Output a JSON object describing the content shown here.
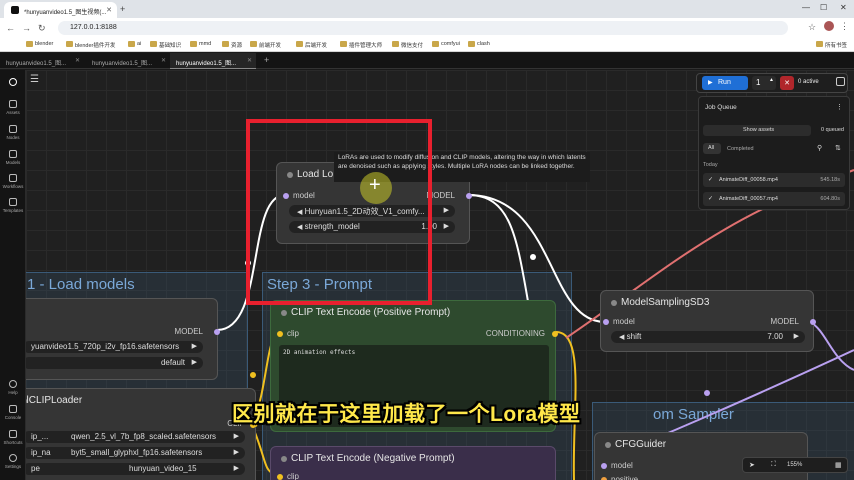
{
  "browser": {
    "tabs": [
      {
        "title": "*hunyuanvideo1.5_图生视频(...",
        "active": true
      }
    ],
    "url": "127.0.0.1:8188",
    "profile": "所有书签",
    "bookmarks": [
      "blender",
      "blender插件开发",
      "ai",
      "基础知识",
      "mmd",
      "资源",
      "前端开发",
      "后端开发",
      "插件管理大师",
      "微信支付",
      "comfyui",
      "clash"
    ]
  },
  "workflow_tabs": [
    {
      "label": "hunyuanvideo1.5_图...",
      "active": false
    },
    {
      "label": "hunyuanvideo1.5_图...",
      "active": false
    },
    {
      "label": "hunyuanvideo1.5_图...",
      "active": true
    }
  ],
  "sidebar": {
    "items": [
      {
        "label": "Assets",
        "icon": "image-icon"
      },
      {
        "label": "Nodes",
        "icon": "nodes-icon"
      },
      {
        "label": "Models",
        "icon": "models-icon"
      },
      {
        "label": "Workflows",
        "icon": "workflow-icon"
      },
      {
        "label": "Templates",
        "icon": "templates-icon"
      },
      {
        "label": "Help",
        "icon": "help-icon"
      },
      {
        "label": "Console",
        "icon": "console-icon"
      },
      {
        "label": "Shortcuts",
        "icon": "keyboard-icon"
      },
      {
        "label": "Settings",
        "icon": "gear-icon"
      }
    ]
  },
  "groups": {
    "load_models": "1 - Load models",
    "prompt": "Step 3 - Prompt",
    "sampler": "om Sampler"
  },
  "nodes": {
    "lora": {
      "title": "Load Lo",
      "input": "model",
      "output": "MODEL",
      "lora_name": "Hunyuan1.5_2D动效_V1_comfy...",
      "strength_label": "strength_model",
      "strength_value": "1.00"
    },
    "unet": {
      "output": "MODEL",
      "model": "yuanvideo1.5_720p_i2v_fp16.safetensors",
      "dtype": "default"
    },
    "clip_loader": {
      "title": "alCLIPLoader",
      "output": "CLIP",
      "w1_label": "ip_...",
      "w1_value": "qwen_2.5_vl_7b_fp8_scaled.safetensors",
      "w2_label": "ip_na",
      "w2_value": "byt5_small_glyphxl_fp16.safetensors",
      "w3_label": "pe",
      "w3_value": "hunyuan_video_15"
    },
    "clip_pos": {
      "title": "CLIP Text Encode (Positive Prompt)",
      "input": "clip",
      "output": "CONDITIONING",
      "text": "2D animation effects"
    },
    "clip_neg": {
      "title": "CLIP Text Encode (Negative Prompt)",
      "input": "clip"
    },
    "model_sampling": {
      "title": "ModelSamplingSD3",
      "input": "model",
      "output": "MODEL",
      "shift_label": "shift",
      "shift_value": "7.00"
    },
    "cfg_guider": {
      "title": "CFGGuider",
      "input1": "model",
      "input2": "positive"
    }
  },
  "tooltip": "LoRAs are used to modify diffusion and CLIP models, altering the way in which latents are denoised such as applying styles. Multiple LoRA nodes can be linked together.",
  "subtitle": "区别就在于这里加载了一个Lora模型",
  "toolbar": {
    "run_label": "Run",
    "run_count": "1",
    "active_label": "0 active"
  },
  "job_queue": {
    "title": "Job Queue",
    "show_assets": "Show assets",
    "queued": "0 queued",
    "filter_all": "All",
    "filter_completed": "Completed",
    "section": "Today",
    "items": [
      {
        "name": "AnimateDiff_00058.mp4",
        "time": "545.18s"
      },
      {
        "name": "AnimateDiff_00057.mp4",
        "time": "604.80s"
      }
    ]
  },
  "zoom": "155%",
  "colors": {
    "accent": "#1f6fd6",
    "highlight": "#e8202e",
    "subtitle": "#ffe84a",
    "clip_link": "#f0c020",
    "model_link": "#b9a0f0"
  }
}
